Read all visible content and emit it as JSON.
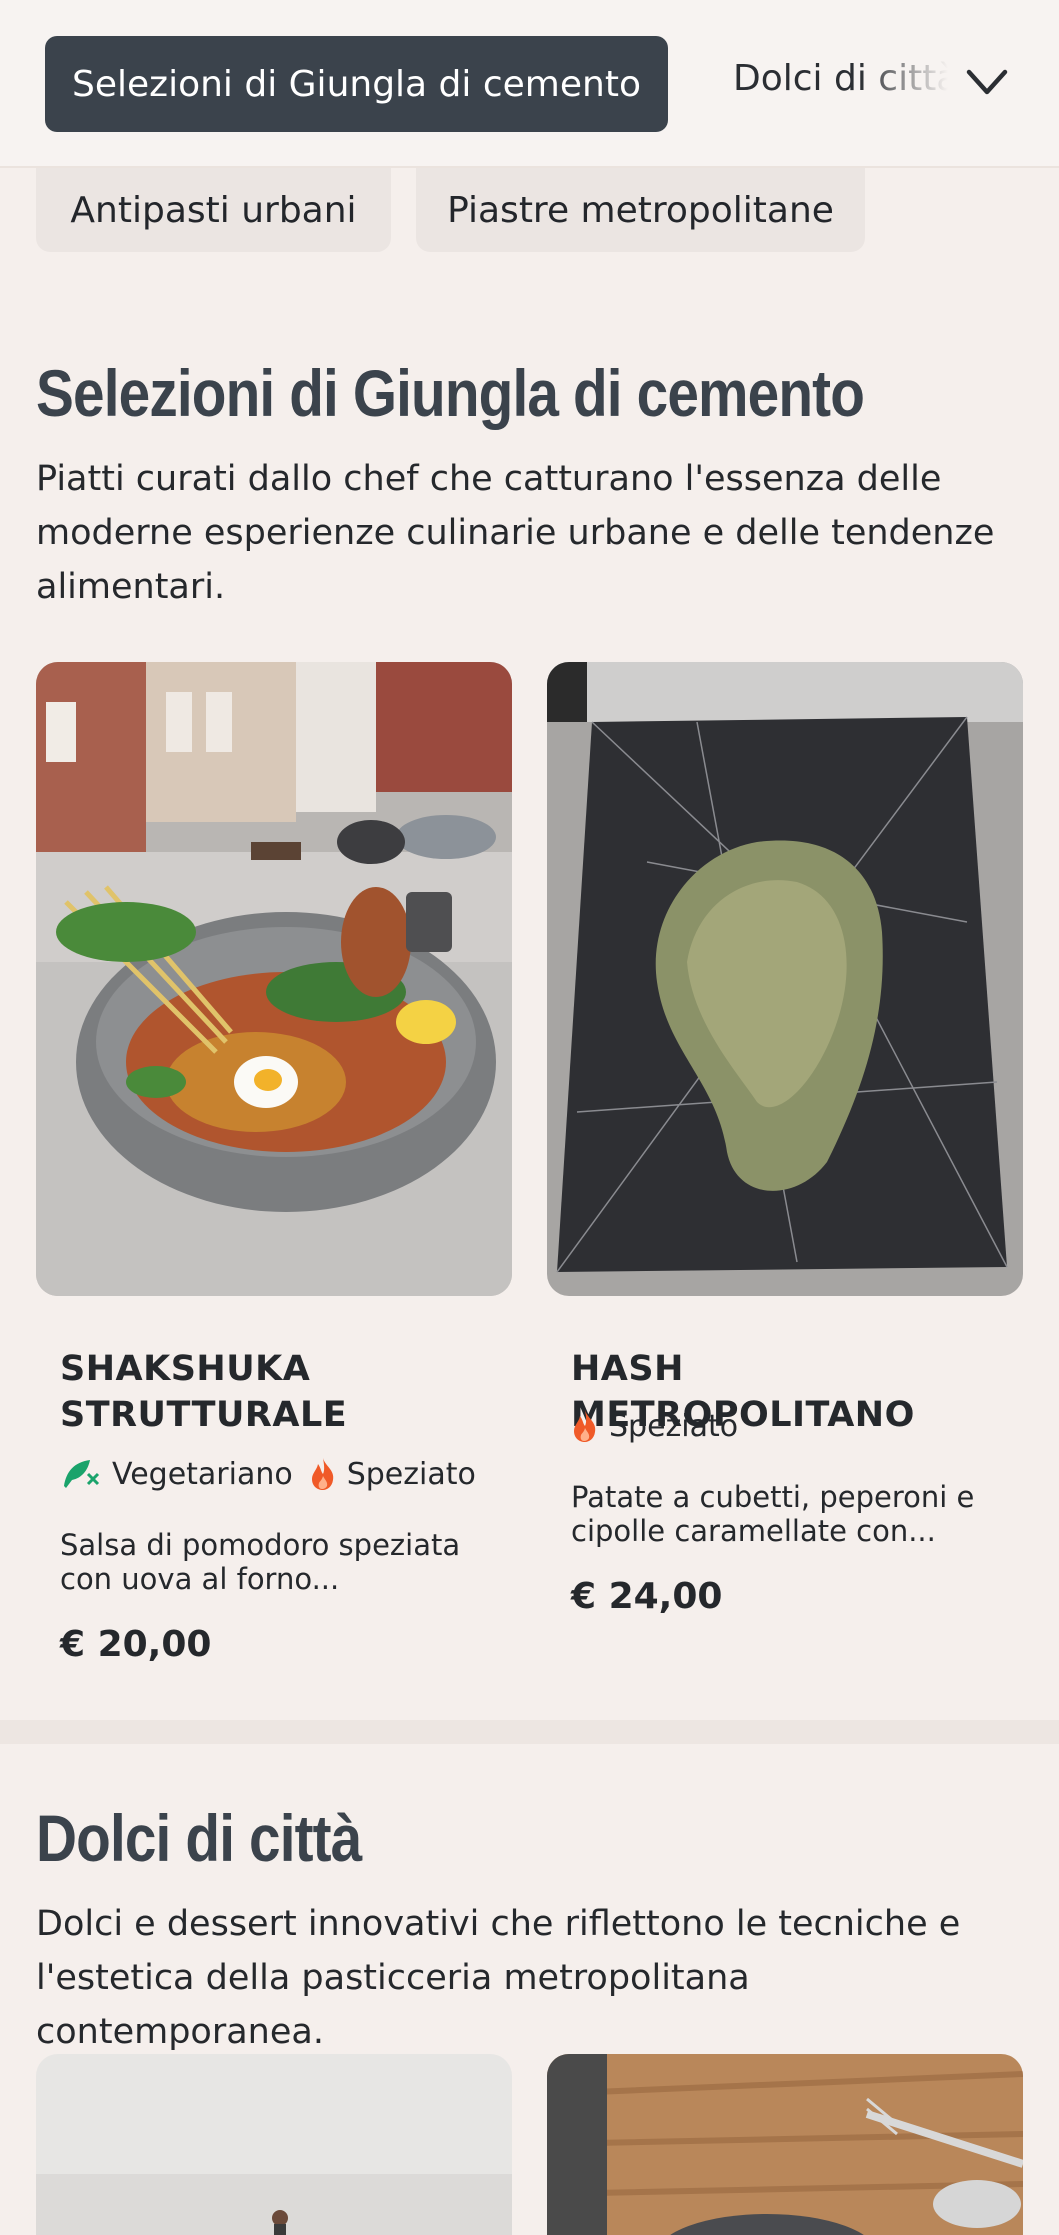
{
  "nav": {
    "active_category": "Selezioni di Giungla di cemento",
    "next_category": "Dolci di città",
    "subcategories": [
      "Antipasti urbani",
      "Piastre metropolitane"
    ]
  },
  "sections": [
    {
      "title": "Selezioni di Giungla di cemento",
      "description": "Piatti curati dallo chef che catturano l'essenza delle moderne esperienze culinarie urbane e delle tendenze alimentari.",
      "items": [
        {
          "name": "SHAKSHUKA STRUTTURALE",
          "tags": [
            "Vegetariano",
            "Speziato"
          ],
          "description": "Salsa di pomodoro speziata con uova al forno...",
          "price": "€ 20,00"
        },
        {
          "name": "HASH METROPOLITANO",
          "tags": [
            "Speziato"
          ],
          "description": "Patate a cubetti, peperoni e cipolle caramellate con...",
          "price": "€ 24,00"
        }
      ]
    },
    {
      "title": "Dolci di città",
      "description": "Dolci e dessert innovativi che riflettono le tecniche e l'estetica della pasticceria metropolitana contemporanea."
    }
  ],
  "colors": {
    "background": "#f5efec",
    "active_pill": "#3b434c",
    "heading": "#3b434c",
    "vegetarian_icon": "#1aa36b",
    "spicy_icon": "#f05a28"
  }
}
